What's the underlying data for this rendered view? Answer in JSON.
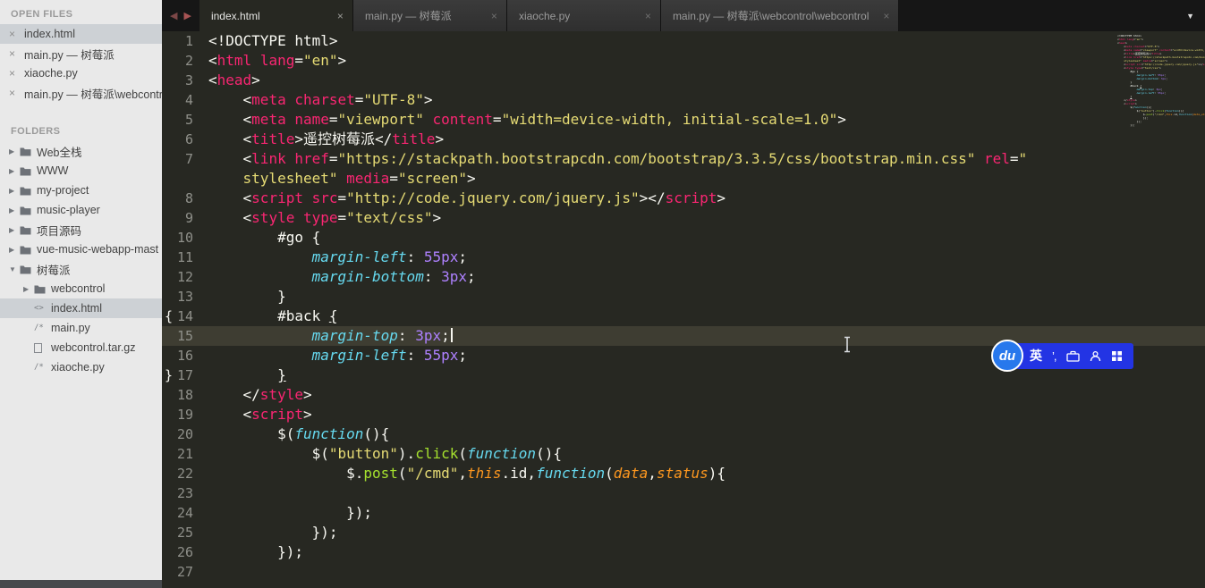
{
  "icons": {
    "close": "×",
    "collapsed": "▶",
    "expanded": "▼",
    "back": "◀",
    "forward": "▶",
    "dropdown": "▼",
    "html_file": "<>",
    "code_file": "/*"
  },
  "sidebar": {
    "open_files_header": "OPEN FILES",
    "open_files": [
      {
        "label": "index.html",
        "selected": true
      },
      {
        "label": "main.py — 树莓派"
      },
      {
        "label": "xiaoche.py"
      },
      {
        "label": "main.py — 树莓派\\webcontr"
      }
    ],
    "folders_header": "FOLDERS",
    "folders": [
      {
        "label": "Web全栈",
        "type": "folder"
      },
      {
        "label": "WWW",
        "type": "folder"
      },
      {
        "label": "my-project",
        "type": "folder"
      },
      {
        "label": "music-player",
        "type": "folder"
      },
      {
        "label": "项目源码",
        "type": "folder"
      },
      {
        "label": "vue-music-webapp-mast",
        "type": "folder"
      },
      {
        "label": "树莓派",
        "type": "folder",
        "expanded": true
      },
      {
        "label": "webcontrol",
        "type": "folder",
        "indent": 1
      },
      {
        "label": "index.html",
        "type": "html",
        "indent": 1,
        "selected": true
      },
      {
        "label": "main.py",
        "type": "code",
        "indent": 1
      },
      {
        "label": "webcontrol.tar.gz",
        "type": "archive",
        "indent": 1
      },
      {
        "label": "xiaoche.py",
        "type": "code",
        "indent": 1
      }
    ]
  },
  "tabs": [
    {
      "title": "index.html",
      "active": true
    },
    {
      "title": "main.py — 树莓派"
    },
    {
      "title": "xiaoche.py"
    },
    {
      "title": "main.py — 树莓派\\webcontrol\\webcontrol"
    }
  ],
  "ime": {
    "logo": "du",
    "mode": "英",
    "punct": "’,"
  },
  "editor": {
    "lines": [
      {
        "n": "1",
        "t": [
          [
            "<!DOCTYPE html>",
            "p"
          ]
        ]
      },
      {
        "n": "2",
        "t": [
          [
            "<",
            "p"
          ],
          [
            "html",
            "tag"
          ],
          [
            " ",
            "p"
          ],
          [
            "lang",
            "attr"
          ],
          [
            "=",
            "p"
          ],
          [
            "\"en\"",
            "str"
          ],
          [
            ">",
            "p"
          ]
        ]
      },
      {
        "n": "3",
        "t": [
          [
            "<",
            "p"
          ],
          [
            "head",
            "tag"
          ],
          [
            ">",
            "p"
          ]
        ]
      },
      {
        "n": "4",
        "t": [
          [
            "    <",
            "p"
          ],
          [
            "meta",
            "tag"
          ],
          [
            " ",
            "p"
          ],
          [
            "charset",
            "attr"
          ],
          [
            "=",
            "p"
          ],
          [
            "\"UTF-8\"",
            "str"
          ],
          [
            ">",
            "p"
          ]
        ]
      },
      {
        "n": "5",
        "t": [
          [
            "    <",
            "p"
          ],
          [
            "meta",
            "tag"
          ],
          [
            " ",
            "p"
          ],
          [
            "name",
            "attr"
          ],
          [
            "=",
            "p"
          ],
          [
            "\"viewport\"",
            "str"
          ],
          [
            " ",
            "p"
          ],
          [
            "content",
            "attr"
          ],
          [
            "=",
            "p"
          ],
          [
            "\"width=device-width, initial-scale=1.0\"",
            "str"
          ],
          [
            ">",
            "p"
          ]
        ]
      },
      {
        "n": "6",
        "t": [
          [
            "    <",
            "p"
          ],
          [
            "title",
            "tag"
          ],
          [
            ">",
            "p"
          ],
          [
            "遥控树莓派",
            "p"
          ],
          [
            "</",
            "p"
          ],
          [
            "title",
            "tag"
          ],
          [
            ">",
            "p"
          ]
        ]
      },
      {
        "n": "7",
        "t": [
          [
            "    <",
            "p"
          ],
          [
            "link",
            "tag"
          ],
          [
            " ",
            "p"
          ],
          [
            "href",
            "attr"
          ],
          [
            "=",
            "p"
          ],
          [
            "\"https://stackpath.bootstrapcdn.com/bootstrap/3.3.5/css/bootstrap.min.css\"",
            "str"
          ],
          [
            " ",
            "p"
          ],
          [
            "rel",
            "attr"
          ],
          [
            "=",
            "p"
          ],
          [
            "\"",
            "str"
          ]
        ]
      },
      {
        "n": "",
        "t": [
          [
            "    ",
            "p"
          ],
          [
            "stylesheet\"",
            "str"
          ],
          [
            " ",
            "p"
          ],
          [
            "media",
            "attr"
          ],
          [
            "=",
            "p"
          ],
          [
            "\"screen\"",
            "str"
          ],
          [
            ">",
            "p"
          ]
        ]
      },
      {
        "n": "8",
        "t": [
          [
            "    <",
            "p"
          ],
          [
            "script",
            "tag"
          ],
          [
            " ",
            "p"
          ],
          [
            "src",
            "attr"
          ],
          [
            "=",
            "p"
          ],
          [
            "\"http://code.jquery.com/jquery.js\"",
            "str"
          ],
          [
            "></",
            "p"
          ],
          [
            "script",
            "tag"
          ],
          [
            ">",
            "p"
          ]
        ]
      },
      {
        "n": "9",
        "t": [
          [
            "    <",
            "p"
          ],
          [
            "style",
            "tag"
          ],
          [
            " ",
            "p"
          ],
          [
            "type",
            "attr"
          ],
          [
            "=",
            "p"
          ],
          [
            "\"text/css\"",
            "str"
          ],
          [
            ">",
            "p"
          ]
        ]
      },
      {
        "n": "10",
        "t": [
          [
            "        #go {",
            "p"
          ]
        ]
      },
      {
        "n": "11",
        "t": [
          [
            "            ",
            "p"
          ],
          [
            "margin-left",
            "css"
          ],
          [
            ": ",
            "p"
          ],
          [
            "55px",
            "num"
          ],
          [
            ";",
            "p"
          ]
        ]
      },
      {
        "n": "12",
        "t": [
          [
            "            ",
            "p"
          ],
          [
            "margin-bottom",
            "css"
          ],
          [
            ": ",
            "p"
          ],
          [
            "3px",
            "num"
          ],
          [
            ";",
            "p"
          ]
        ]
      },
      {
        "n": "13",
        "t": [
          [
            "        }",
            "p"
          ]
        ]
      },
      {
        "n": "14",
        "note": "{",
        "t": [
          [
            "        #back ",
            "p"
          ],
          [
            "{",
            "p u"
          ]
        ]
      },
      {
        "n": "15",
        "a": true,
        "c": true,
        "t": [
          [
            "            ",
            "p"
          ],
          [
            "margin-top",
            "css"
          ],
          [
            ": ",
            "p"
          ],
          [
            "3px",
            "num"
          ],
          [
            ";",
            "p"
          ]
        ]
      },
      {
        "n": "16",
        "t": [
          [
            "            ",
            "p"
          ],
          [
            "margin-left",
            "css"
          ],
          [
            ": ",
            "p"
          ],
          [
            "55px",
            "num"
          ],
          [
            ";",
            "p"
          ]
        ]
      },
      {
        "n": "17",
        "note": "}",
        "t": [
          [
            "        ",
            "p"
          ],
          [
            "}",
            "p u"
          ]
        ]
      },
      {
        "n": "18",
        "t": [
          [
            "    </",
            "p"
          ],
          [
            "style",
            "tag"
          ],
          [
            ">",
            "p"
          ]
        ]
      },
      {
        "n": "19",
        "t": [
          [
            "    <",
            "p"
          ],
          [
            "script",
            "tag"
          ],
          [
            ">",
            "p"
          ]
        ]
      },
      {
        "n": "20",
        "t": [
          [
            "        $(",
            "p"
          ],
          [
            "function",
            "kw"
          ],
          [
            "(){",
            "p"
          ]
        ]
      },
      {
        "n": "21",
        "t": [
          [
            "            $(",
            "p"
          ],
          [
            "\"button\"",
            "str"
          ],
          [
            ").",
            "p"
          ],
          [
            "click",
            "fn"
          ],
          [
            "(",
            "p"
          ],
          [
            "function",
            "kw"
          ],
          [
            "(){",
            "p"
          ]
        ]
      },
      {
        "n": "22",
        "t": [
          [
            "                $.",
            "p"
          ],
          [
            "post",
            "fn"
          ],
          [
            "(",
            "p"
          ],
          [
            "\"/cmd\"",
            "str"
          ],
          [
            ",",
            "p"
          ],
          [
            "this",
            "par"
          ],
          [
            ".id,",
            "p"
          ],
          [
            "function",
            "kw"
          ],
          [
            "(",
            "p"
          ],
          [
            "data",
            "par"
          ],
          [
            ",",
            "p"
          ],
          [
            "status",
            "par"
          ],
          [
            "){",
            "p"
          ]
        ]
      },
      {
        "n": "23",
        "t": []
      },
      {
        "n": "24",
        "t": [
          [
            "                });",
            "p"
          ]
        ]
      },
      {
        "n": "25",
        "t": [
          [
            "            });",
            "p"
          ]
        ]
      },
      {
        "n": "26",
        "t": [
          [
            "        });",
            "p"
          ]
        ]
      },
      {
        "n": "27",
        "t": []
      }
    ]
  }
}
